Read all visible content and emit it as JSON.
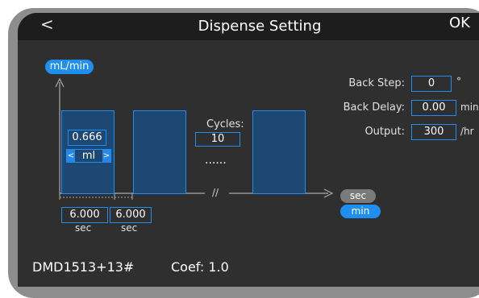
{
  "header": {
    "back_symbol": "<",
    "title": "Dispense Setting",
    "ok_label": "OK"
  },
  "chart": {
    "y_unit": "mL/min",
    "volume": "0.666",
    "volume_unit": "ml",
    "arrow_left": "<",
    "arrow_right": ">",
    "cycles_label": "Cycles:",
    "cycles_value": "10",
    "ellipsis": "......",
    "break_mark": "//",
    "time1_value": "6.000",
    "time1_unit": "sec",
    "time2_value": "6.000",
    "time2_unit": "sec",
    "x_unit_options": [
      "sec",
      "min"
    ],
    "x_unit_selected": "min"
  },
  "settings": [
    {
      "label": "Back Step:",
      "value": "0",
      "unit": "°"
    },
    {
      "label": "Back Delay:",
      "value": "0.00",
      "unit": "min"
    },
    {
      "label": "Output:",
      "value": "300",
      "unit": "/hr"
    }
  ],
  "footer": {
    "device": "DMD1513+13#",
    "coef": "Coef: 1.0"
  },
  "colors": {
    "accent": "#1f8ef1",
    "background": "#2f2f2f",
    "header": "#1d1d1d",
    "bar_fill": "#1c4873"
  }
}
